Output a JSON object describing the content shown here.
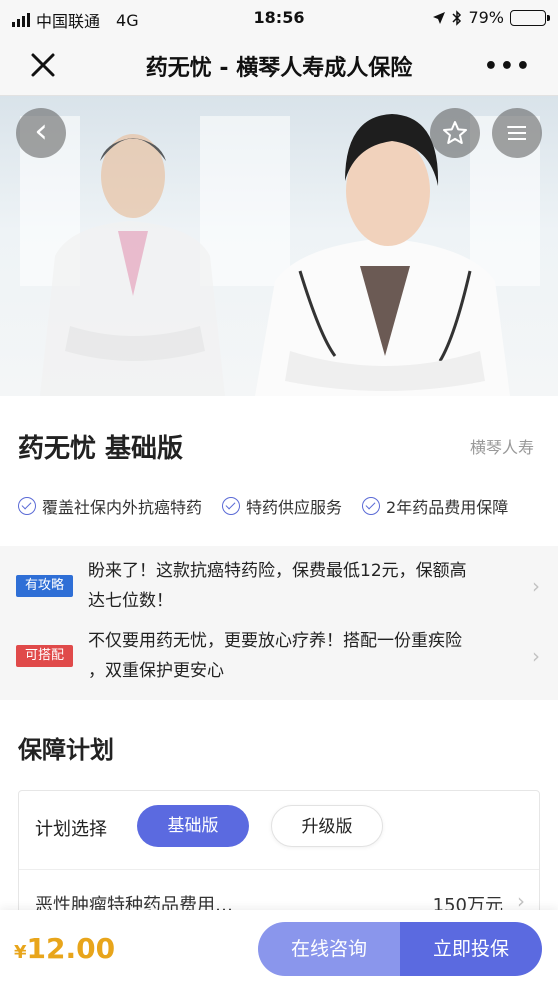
{
  "status_bar": {
    "carrier": "中国联通",
    "network": "4G",
    "time": "18:56",
    "battery": "79%",
    "battery_level": 0.79
  },
  "navbar": {
    "title": "药无忧 - 横琴人寿成人保险",
    "more": "•••"
  },
  "hero": {
    "back_glyph": "‹"
  },
  "product": {
    "name": "药无忧 基础版",
    "company": "横琴人寿",
    "features": [
      "覆盖社保内外抗癌特药",
      "特药供应服务",
      "2年药品费用保障"
    ]
  },
  "tips": [
    {
      "badge": "有攻略",
      "badge_color": "#2f6fd6",
      "line1": "盼来了！这款抗癌特药险，保费最低12元，保额高",
      "line2": "达七位数！"
    },
    {
      "badge": "可搭配",
      "badge_color": "#e04a4a",
      "line1": "不仅要用药无忧，更要放心疗养！搭配一份重疾险",
      "line2": "，双重保护更安心"
    }
  ],
  "plan": {
    "section_title": "保障计划",
    "select_label": "计划选择",
    "options": [
      "基础版",
      "升级版"
    ],
    "selected": "基础版",
    "row_label": "恶性肿瘤特种药品费用…",
    "row_value": "150万元"
  },
  "bottom": {
    "currency": "¥",
    "price": "12.00",
    "consult_label": "在线咨询",
    "buy_label": "立即投保"
  },
  "colors": {
    "accent": "#5b6ae0",
    "accent_light": "#8a96ec",
    "price": "#e8a51b"
  }
}
